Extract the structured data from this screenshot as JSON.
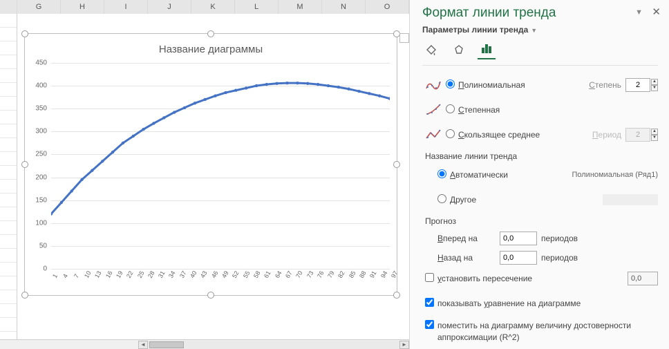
{
  "columns": [
    "G",
    "H",
    "I",
    "J",
    "K",
    "L",
    "M",
    "N",
    "O"
  ],
  "chart": {
    "title": "Название диаграммы",
    "y_ticks": [
      0,
      50,
      100,
      150,
      200,
      250,
      300,
      350,
      400,
      450
    ],
    "x_ticks": [
      1,
      4,
      7,
      10,
      13,
      16,
      19,
      22,
      25,
      28,
      31,
      34,
      37,
      40,
      43,
      46,
      49,
      52,
      55,
      58,
      61,
      64,
      67,
      70,
      73,
      76,
      79,
      82,
      85,
      88,
      91,
      94,
      97
    ]
  },
  "chart_data": {
    "type": "scatter",
    "title": "Название диаграммы",
    "xlabel": "",
    "ylabel": "",
    "xlim": [
      1,
      100
    ],
    "ylim": [
      0,
      450
    ],
    "x": [
      1,
      4,
      7,
      10,
      13,
      16,
      19,
      22,
      25,
      28,
      31,
      34,
      37,
      40,
      43,
      46,
      49,
      52,
      55,
      58,
      61,
      64,
      67,
      70,
      73,
      76,
      79,
      82,
      85,
      88,
      91,
      94,
      97,
      100
    ],
    "values": [
      120,
      145,
      170,
      195,
      215,
      235,
      255,
      275,
      290,
      305,
      318,
      330,
      342,
      352,
      362,
      370,
      378,
      385,
      390,
      395,
      400,
      403,
      405,
      406,
      406,
      405,
      403,
      400,
      397,
      393,
      388,
      383,
      378,
      372
    ],
    "trendline": {
      "type": "polynomial",
      "degree": 2
    }
  },
  "pane": {
    "title": "Формат линии тренда",
    "subtitle": "Параметры линии тренда",
    "types": {
      "poly": "Полиномиальная",
      "power": "Степенная",
      "movavg": "Скользящее среднее"
    },
    "degree_label": "Степень",
    "degree_value": "2",
    "period_label": "Период",
    "period_value": "2",
    "name_section": "Название линии тренда",
    "name_auto": "Автоматически",
    "name_auto_value": "Полиномиальная (Ряд1)",
    "name_other": "Другое",
    "forecast_section": "Прогноз",
    "forward_label": "Вперед на",
    "backward_label": "Назад на",
    "forward_value": "0,0",
    "backward_value": "0,0",
    "periods_unit": "периодов",
    "intercept_label": "установить пересечение",
    "intercept_value": "0,0",
    "show_eq": "показывать уравнение на диаграмме",
    "show_r2": "поместить на диаграмму величину достоверности аппроксимации (R^2)"
  }
}
